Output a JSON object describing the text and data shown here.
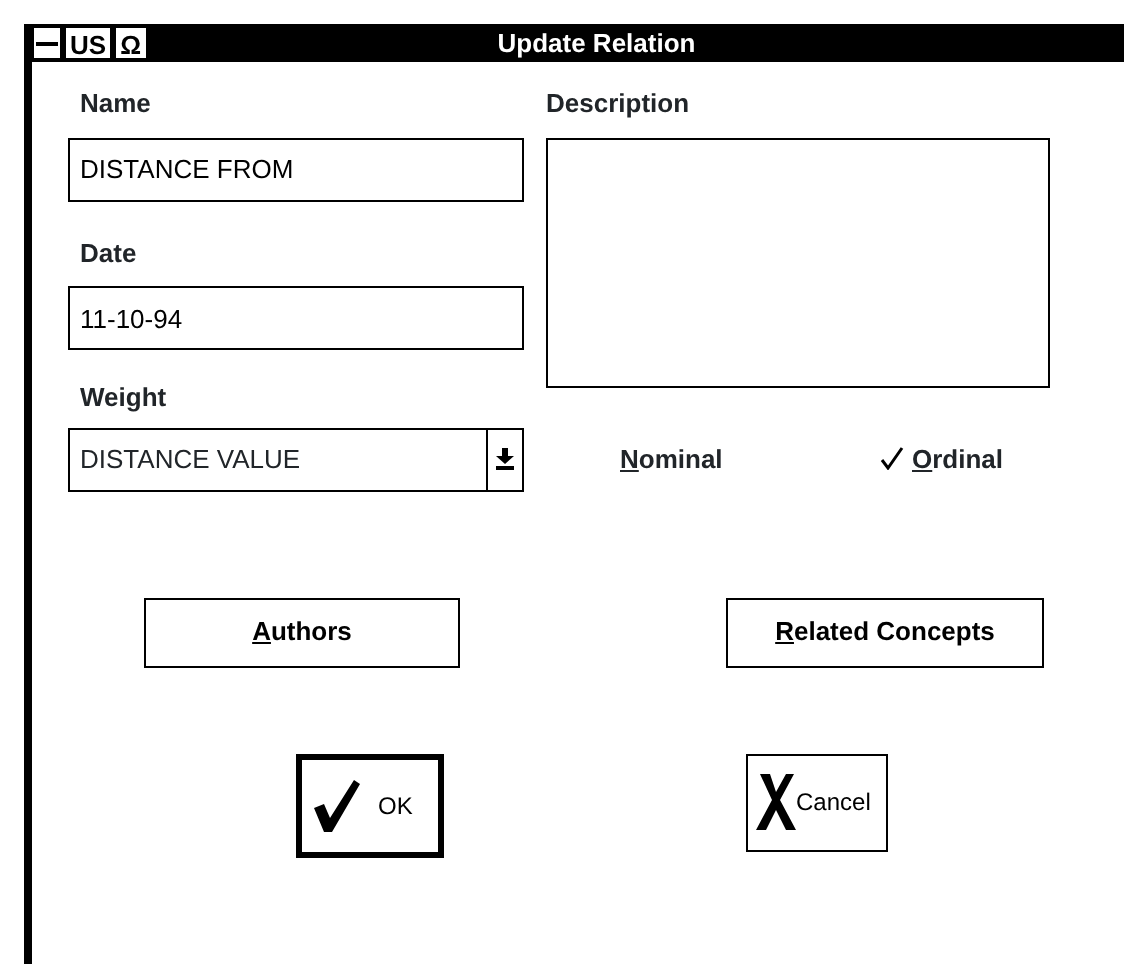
{
  "window": {
    "title": "Update Relation",
    "title_buttons": [
      "US",
      "Ω"
    ]
  },
  "fields": [
    {
      "label": "Name",
      "value": "DISTANCE FROM"
    },
    {
      "label": "Date",
      "value": "11-10-94"
    }
  ],
  "weight": {
    "label": "Weight",
    "value": "DISTANCE VALUE"
  },
  "description": {
    "label": "Description"
  },
  "options": [
    {
      "label": "Nominal",
      "checked": false
    },
    {
      "label": "Ordinal",
      "checked": true
    }
  ],
  "buttons": [
    {
      "label": "Authors",
      "kind": "plain"
    },
    {
      "label": "Related Concepts",
      "kind": "plain"
    }
  ],
  "dialog_buttons": [
    {
      "label": "OK",
      "kind": "ok",
      "default": true
    },
    {
      "label": "Cancel",
      "kind": "cancel",
      "default": false
    }
  ]
}
